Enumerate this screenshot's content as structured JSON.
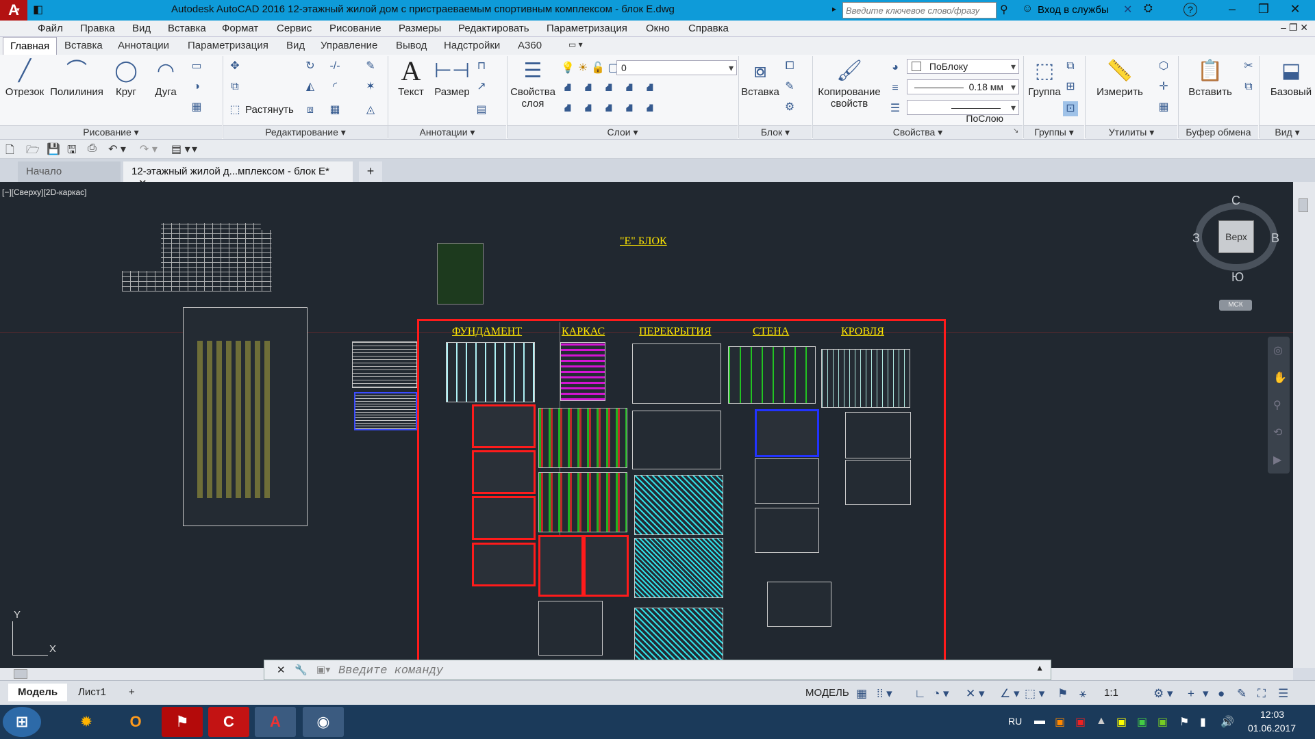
{
  "window": {
    "app_logo": "A",
    "title": "Autodesk AutoCAD 2016   12-этажный жилой дом с пристраеваемым спортивным комплексом - блок E.dwg",
    "search_placeholder": "Введите ключевое слово/фразу",
    "login": "Вход в службы",
    "help": "?"
  },
  "menu": [
    "Файл",
    "Правка",
    "Вид",
    "Вставка",
    "Формат",
    "Сервис",
    "Рисование",
    "Размеры",
    "Редактировать",
    "Параметризация",
    "Окно",
    "Справка"
  ],
  "ribbon_tabs": [
    "Главная",
    "Вставка",
    "Аннотации",
    "Параметризация",
    "Вид",
    "Управление",
    "Вывод",
    "Надстройки",
    "A360"
  ],
  "ribbon": {
    "draw": {
      "line": "Отрезок",
      "polyline": "Полилиния",
      "circle": "Круг",
      "arc": "Дуга",
      "title": "Рисование"
    },
    "modify": {
      "stretch": "Растянуть",
      "title": "Редактирование"
    },
    "annot": {
      "text": "Текст",
      "dimension": "Размер",
      "title": "Аннотации"
    },
    "layers": {
      "props_line1": "Свойства",
      "props_line2": "слоя",
      "current_layer": "0",
      "title": "Слои"
    },
    "block": {
      "insert": "Вставка",
      "title": "Блок"
    },
    "properties": {
      "copy_line1": "Копирование",
      "copy_line2": "свойств",
      "color": "ПоБлоку",
      "lineweight": "0.18 мм",
      "linetype": "ПоСлою",
      "title": "Свойства"
    },
    "groups": {
      "group": "Группа",
      "title": "Группы"
    },
    "utilities": {
      "measure": "Измерить",
      "title": "Утилиты"
    },
    "clipboard": {
      "paste": "Вставить",
      "title": "Буфер обмена"
    },
    "view": {
      "base": "Базовый",
      "title": "Вид"
    }
  },
  "doc_tabs": {
    "start": "Начало",
    "current": "12-этажный жилой д...мплексом - блок E*",
    "add": "+"
  },
  "viewport": {
    "label": "[−][Сверху][2D-каркас]",
    "block_title": "\"Е\" БЛОК",
    "sections": [
      "ФУНДАМЕНТ",
      "КАРКАС",
      "ПЕРЕКРЫТИЯ",
      "СТЕНА",
      "КРОВЛЯ"
    ],
    "ucs_y": "Y",
    "ucs_x": "X"
  },
  "viewcube": {
    "north": "С",
    "south": "Ю",
    "east": "В",
    "west": "З",
    "top": "Верх",
    "ucs": "МСК"
  },
  "command_line": {
    "placeholder": "Введите команду"
  },
  "layout_tabs": [
    "Модель",
    "Лист1"
  ],
  "status": {
    "space": "МОДЕЛЬ",
    "scale": "1:1"
  },
  "taskbar": {
    "lang": "RU",
    "time": "12:03",
    "date": "01.06.2017"
  }
}
